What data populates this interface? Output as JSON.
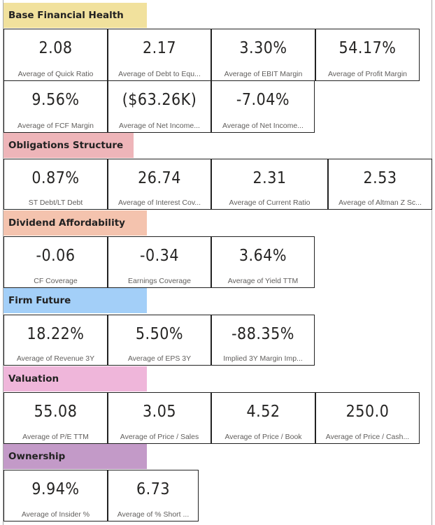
{
  "sections": [
    {
      "title": "Base Financial Health",
      "color": "#f1e19d",
      "cards": [
        {
          "value": "2.08",
          "label": "Average of Quick Ratio"
        },
        {
          "value": "2.17",
          "label": "Average of Debt to Equ..."
        },
        {
          "value": "3.30%",
          "label": "Average of EBIT Margin"
        },
        {
          "value": "54.17%",
          "label": "Average of Profit Margin"
        },
        {
          "value": "9.56%",
          "label": "Average of FCF Margin"
        },
        {
          "value": "($63.26K)",
          "label": "Average of Net Income..."
        },
        {
          "value": "-7.04%",
          "label": "Average of Net Income..."
        }
      ]
    },
    {
      "title": "Obligations Structure",
      "color": "#eeb5b9",
      "cards": [
        {
          "value": "0.87%",
          "label": "ST Debt/LT Debt"
        },
        {
          "value": "26.74",
          "label": "Average of Interest Cov..."
        },
        {
          "value": "2.31",
          "label": "Average of Current Ratio"
        },
        {
          "value": "2.53",
          "label": "Average of Altman Z Sc..."
        }
      ]
    },
    {
      "title": "Dividend Affordability",
      "color": "#f4c3ae",
      "cards": [
        {
          "value": "-0.06",
          "label": "CF Coverage"
        },
        {
          "value": "-0.34",
          "label": "Earnings Coverage"
        },
        {
          "value": "3.64%",
          "label": "Average of Yield TTM"
        }
      ]
    },
    {
      "title": "Firm Future",
      "color": "#a3cff8",
      "cards": [
        {
          "value": "18.22%",
          "label": "Average of Revenue 3Y"
        },
        {
          "value": "5.50%",
          "label": "Average of EPS 3Y"
        },
        {
          "value": "-88.35%",
          "label": "Implied 3Y Margin Imp..."
        }
      ]
    },
    {
      "title": "Valuation",
      "color": "#efb6da",
      "cards": [
        {
          "value": "55.08",
          "label": "Average of P/E TTM"
        },
        {
          "value": "3.05",
          "label": "Average of Price / Sales"
        },
        {
          "value": "4.52",
          "label": "Average of Price / Book"
        },
        {
          "value": "250.0",
          "label": "Average of Price / Cash..."
        }
      ]
    },
    {
      "title": "Ownership",
      "color": "#c39ac8",
      "cards": [
        {
          "value": "9.94%",
          "label": "Average of Insider %"
        },
        {
          "value": "6.73",
          "label": "Average of % Short ..."
        }
      ]
    }
  ]
}
